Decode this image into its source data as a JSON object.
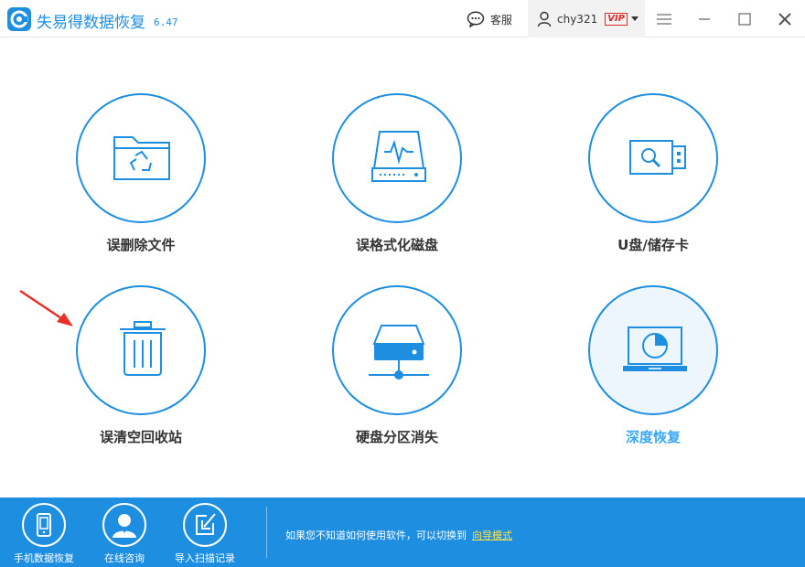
{
  "app": {
    "title": "失易得数据恢复",
    "version": "6.47"
  },
  "titlebar": {
    "customer_service": "客服",
    "user": {
      "name": "chy321",
      "badge": "VIP"
    }
  },
  "tiles": [
    {
      "label": "误删除文件",
      "icon": "folder-recycle-icon"
    },
    {
      "label": "误格式化磁盘",
      "icon": "hard-drive-icon"
    },
    {
      "label": "U盘/储存卡",
      "icon": "usb-drive-icon"
    },
    {
      "label": "误清空回收站",
      "icon": "trash-bin-icon"
    },
    {
      "label": "硬盘分区消失",
      "icon": "network-drive-icon"
    },
    {
      "label": "深度恢复",
      "icon": "laptop-disk-icon",
      "active": true
    }
  ],
  "bottombar": {
    "items": [
      {
        "label": "手机数据恢复",
        "icon": "phone-icon"
      },
      {
        "label": "在线咨询",
        "icon": "user-icon"
      },
      {
        "label": "导入扫描记录",
        "icon": "import-icon"
      }
    ],
    "hint_text": "如果您不知道如何使用软件，可以切换到",
    "hint_link": "向导模式"
  },
  "colors": {
    "accent": "#1e8fe0",
    "active_label": "#39a8ef",
    "link": "#ffe14a",
    "vip": "#d92b2b",
    "arrow": "#e8302a"
  }
}
